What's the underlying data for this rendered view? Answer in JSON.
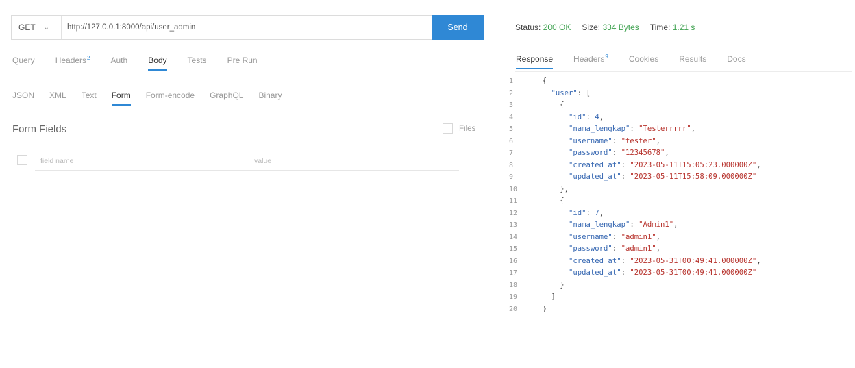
{
  "request": {
    "method": "GET",
    "url": "http://127.0.0.1:8000/api/user_admin",
    "send_label": "Send",
    "tabs": [
      {
        "label": "Query",
        "badge": ""
      },
      {
        "label": "Headers",
        "badge": "2"
      },
      {
        "label": "Auth",
        "badge": ""
      },
      {
        "label": "Body",
        "badge": ""
      },
      {
        "label": "Tests",
        "badge": ""
      },
      {
        "label": "Pre Run",
        "badge": ""
      }
    ],
    "active_tab": "Body",
    "body_tabs": [
      "JSON",
      "XML",
      "Text",
      "Form",
      "Form-encode",
      "GraphQL",
      "Binary"
    ],
    "active_body_tab": "Form",
    "form_title": "Form Fields",
    "files_label": "Files",
    "field_name_placeholder": "field name",
    "field_value_placeholder": "value"
  },
  "response": {
    "status_label": "Status:",
    "status_value": "200 OK",
    "size_label": "Size:",
    "size_value": "334 Bytes",
    "time_label": "Time:",
    "time_value": "1.21 s",
    "tabs": [
      {
        "label": "Response",
        "badge": ""
      },
      {
        "label": "Headers",
        "badge": "9"
      },
      {
        "label": "Cookies",
        "badge": ""
      },
      {
        "label": "Results",
        "badge": ""
      },
      {
        "label": "Docs",
        "badge": ""
      }
    ],
    "active_tab": "Response",
    "body_lines": [
      {
        "n": "1",
        "indent": 0,
        "tokens": [
          [
            "p",
            "{"
          ]
        ]
      },
      {
        "n": "2",
        "indent": 1,
        "tokens": [
          [
            "k",
            "\"user\""
          ],
          [
            "p",
            ": ["
          ]
        ]
      },
      {
        "n": "3",
        "indent": 2,
        "tokens": [
          [
            "p",
            "{"
          ]
        ]
      },
      {
        "n": "4",
        "indent": 3,
        "tokens": [
          [
            "k",
            "\"id\""
          ],
          [
            "p",
            ": "
          ],
          [
            "n",
            "4"
          ],
          [
            "p",
            ","
          ]
        ]
      },
      {
        "n": "5",
        "indent": 3,
        "tokens": [
          [
            "k",
            "\"nama_lengkap\""
          ],
          [
            "p",
            ": "
          ],
          [
            "s",
            "\"Testerrrrr\""
          ],
          [
            "p",
            ","
          ]
        ]
      },
      {
        "n": "6",
        "indent": 3,
        "tokens": [
          [
            "k",
            "\"username\""
          ],
          [
            "p",
            ": "
          ],
          [
            "s",
            "\"tester\""
          ],
          [
            "p",
            ","
          ]
        ]
      },
      {
        "n": "7",
        "indent": 3,
        "tokens": [
          [
            "k",
            "\"password\""
          ],
          [
            "p",
            ": "
          ],
          [
            "s",
            "\"12345678\""
          ],
          [
            "p",
            ","
          ]
        ]
      },
      {
        "n": "8",
        "indent": 3,
        "tokens": [
          [
            "k",
            "\"created_at\""
          ],
          [
            "p",
            ": "
          ],
          [
            "s",
            "\"2023-05-11T15:05:23.000000Z\""
          ],
          [
            "p",
            ","
          ]
        ]
      },
      {
        "n": "9",
        "indent": 3,
        "tokens": [
          [
            "k",
            "\"updated_at\""
          ],
          [
            "p",
            ": "
          ],
          [
            "s",
            "\"2023-05-11T15:58:09.000000Z\""
          ]
        ]
      },
      {
        "n": "10",
        "indent": 2,
        "tokens": [
          [
            "p",
            "},"
          ]
        ]
      },
      {
        "n": "11",
        "indent": 2,
        "tokens": [
          [
            "p",
            "{"
          ]
        ]
      },
      {
        "n": "12",
        "indent": 3,
        "tokens": [
          [
            "k",
            "\"id\""
          ],
          [
            "p",
            ": "
          ],
          [
            "n",
            "7"
          ],
          [
            "p",
            ","
          ]
        ]
      },
      {
        "n": "13",
        "indent": 3,
        "tokens": [
          [
            "k",
            "\"nama_lengkap\""
          ],
          [
            "p",
            ": "
          ],
          [
            "s",
            "\"Admin1\""
          ],
          [
            "p",
            ","
          ]
        ]
      },
      {
        "n": "14",
        "indent": 3,
        "tokens": [
          [
            "k",
            "\"username\""
          ],
          [
            "p",
            ": "
          ],
          [
            "s",
            "\"admin1\""
          ],
          [
            "p",
            ","
          ]
        ]
      },
      {
        "n": "15",
        "indent": 3,
        "tokens": [
          [
            "k",
            "\"password\""
          ],
          [
            "p",
            ": "
          ],
          [
            "s",
            "\"admin1\""
          ],
          [
            "p",
            ","
          ]
        ]
      },
      {
        "n": "16",
        "indent": 3,
        "tokens": [
          [
            "k",
            "\"created_at\""
          ],
          [
            "p",
            ": "
          ],
          [
            "s",
            "\"2023-05-31T00:49:41.000000Z\""
          ],
          [
            "p",
            ","
          ]
        ]
      },
      {
        "n": "17",
        "indent": 3,
        "tokens": [
          [
            "k",
            "\"updated_at\""
          ],
          [
            "p",
            ": "
          ],
          [
            "s",
            "\"2023-05-31T00:49:41.000000Z\""
          ]
        ]
      },
      {
        "n": "18",
        "indent": 2,
        "tokens": [
          [
            "p",
            "}"
          ]
        ]
      },
      {
        "n": "19",
        "indent": 1,
        "tokens": [
          [
            "p",
            "]"
          ]
        ]
      },
      {
        "n": "20",
        "indent": 0,
        "tokens": [
          [
            "p",
            "}"
          ]
        ]
      }
    ]
  },
  "colors": {
    "accent": "#2f88d5",
    "status_ok": "#3ea14f",
    "json_key": "#3a6ab3",
    "json_string": "#b7332d"
  },
  "icons": {
    "method_dropdown": "chevron-down-icon"
  }
}
